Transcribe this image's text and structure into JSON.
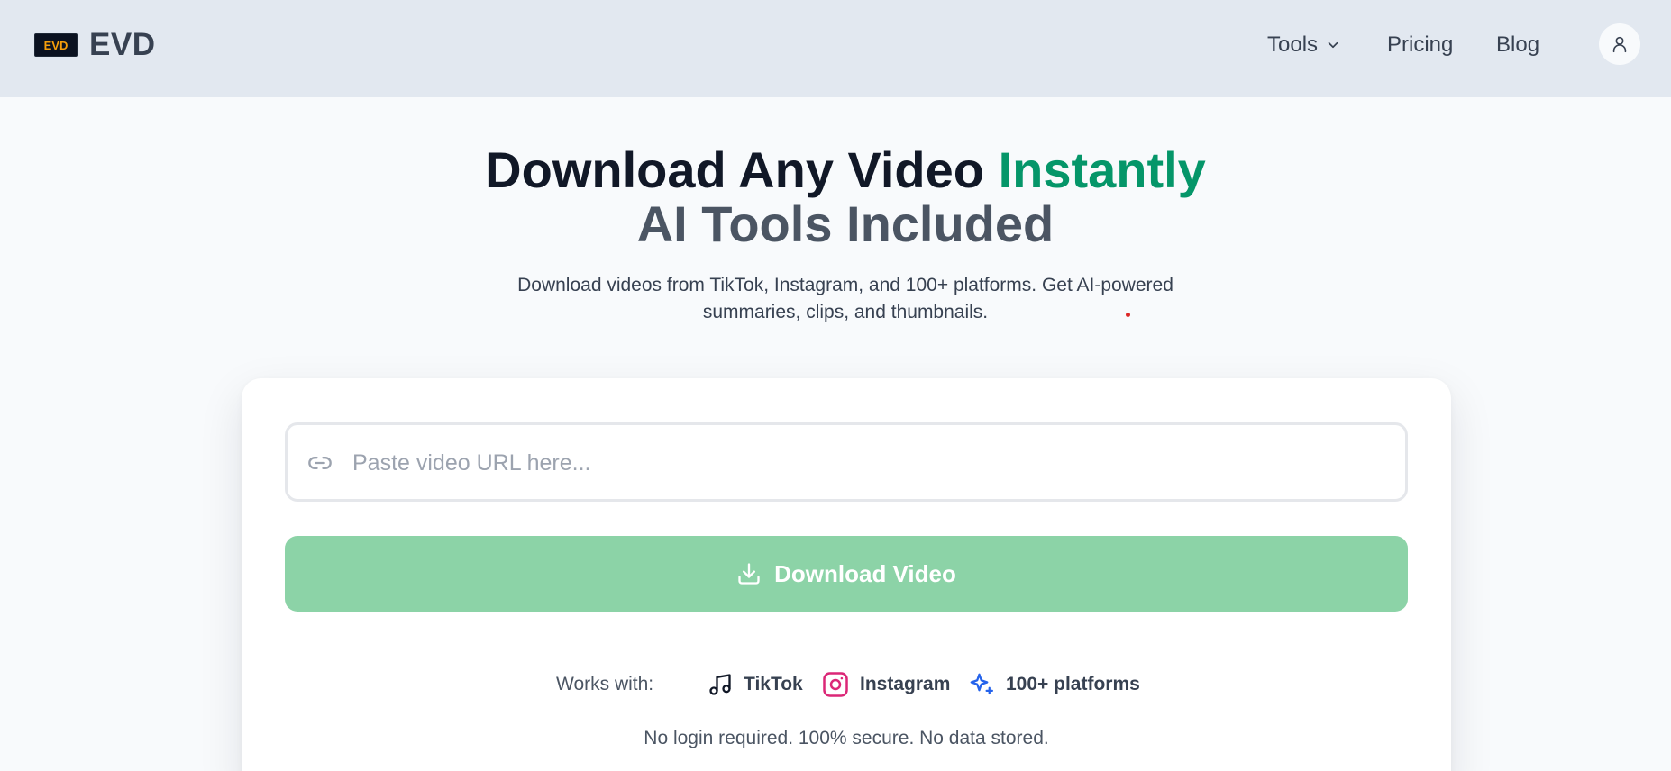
{
  "header": {
    "brand_name": "EVD",
    "logo_text": "EVD",
    "nav": {
      "tools": "Tools",
      "pricing": "Pricing",
      "blog": "Blog"
    }
  },
  "hero": {
    "title_main": "Download Any Video ",
    "title_accent": "Instantly",
    "title_line2": "AI Tools Included",
    "subtitle": "Download videos from TikTok, Instagram, and 100+ platforms. Get AI-powered summaries, clips, and thumbnails."
  },
  "form": {
    "url_value": "",
    "url_placeholder": "Paste video URL here...",
    "download_label": "Download Video"
  },
  "works_with": {
    "label": "Works with:",
    "platforms": [
      {
        "name": "TikTok",
        "icon": "music-note-icon"
      },
      {
        "name": "Instagram",
        "icon": "instagram-icon"
      },
      {
        "name": "100+ platforms",
        "icon": "sparkles-icon"
      }
    ]
  },
  "note": "No login required. 100% secure. No data stored.",
  "colors": {
    "accent": "#059669",
    "button": "#8cd3a7",
    "header_bg": "#e2e8f0",
    "instagram": "#db2777",
    "sparkles": "#2563eb"
  }
}
